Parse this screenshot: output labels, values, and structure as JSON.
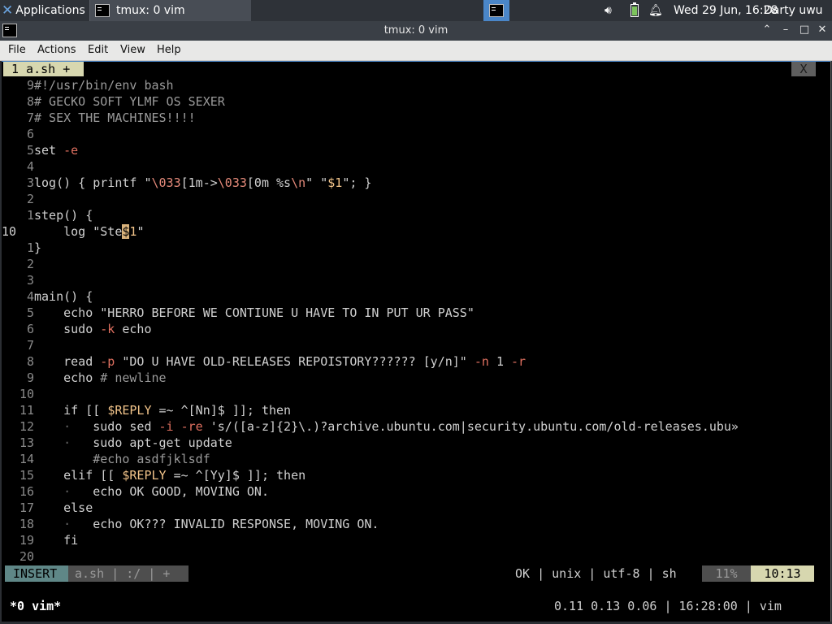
{
  "panel": {
    "apps_label": "Applications",
    "task_label": "tmux: 0 vim",
    "clock": "Wed 29 Jun, 16:28",
    "user": "Darty uwu"
  },
  "window": {
    "title": "tmux: 0 vim",
    "buttons": {
      "up": "⌃",
      "minimize": "–",
      "maximize": "□",
      "close": "✕"
    }
  },
  "menu": [
    "File",
    "Actions",
    "Edit",
    "View",
    "Help"
  ],
  "vim": {
    "tab_label": "1 a.sh +",
    "tab_close": "X",
    "lines": [
      {
        "num": "9",
        "text": "#!/usr/bin/env bash"
      },
      {
        "num": "8",
        "text": "# GECKO SOFT YLMF OS SEXER"
      },
      {
        "num": "7",
        "text": "# SEX THE MACHINES!!!!"
      },
      {
        "num": "6",
        "text": ""
      },
      {
        "num": "5",
        "text": "set -e"
      },
      {
        "num": "4",
        "text": ""
      },
      {
        "num": "3",
        "text": "log() { printf \"\\033[1m->\\033[0m %s\\n\" \"$1\"; }"
      },
      {
        "num": "2",
        "text": ""
      },
      {
        "num": "1",
        "text": "step() {"
      },
      {
        "num": "10",
        "text": "    log \"Ste$1\""
      },
      {
        "num": "1",
        "text": "}"
      },
      {
        "num": "2",
        "text": ""
      },
      {
        "num": "3",
        "text": ""
      },
      {
        "num": "4",
        "text": "main() {"
      },
      {
        "num": "5",
        "text": "    echo \"HERRO BEFORE WE CONTIUNE U HAVE TO IN PUT UR PASS\""
      },
      {
        "num": "6",
        "text": "    sudo -k echo"
      },
      {
        "num": "7",
        "text": ""
      },
      {
        "num": "8",
        "text": "    read -p \"DO U HAVE OLD-RELEASES REPOISTORY?????? [y/n]\" -n 1 -r"
      },
      {
        "num": "9",
        "text": "    echo # newline"
      },
      {
        "num": "10",
        "text": ""
      },
      {
        "num": "11",
        "text": "    if [[ $REPLY =~ ^[Nn]$ ]]; then"
      },
      {
        "num": "12",
        "text": "        sudo sed -i -re 's/([a-z]{2}\\.)?archive.ubuntu.com|security.ubuntu.com/old-releases.ubu»"
      },
      {
        "num": "13",
        "text": "        sudo apt-get update"
      },
      {
        "num": "14",
        "text": "        #echo asdfjklsdf"
      },
      {
        "num": "15",
        "text": "    elif [[ $REPLY =~ ^[Yy]$ ]]; then"
      },
      {
        "num": "16",
        "text": "        echo OK GOOD, MOVING ON."
      },
      {
        "num": "17",
        "text": "    else"
      },
      {
        "num": "18",
        "text": "        echo OK??? INVALID RESPONSE, MOVING ON."
      },
      {
        "num": "19",
        "text": "    fi"
      },
      {
        "num": "20",
        "text": ""
      }
    ],
    "status": {
      "mode": "INSERT",
      "file": "a.sh  |  :/  |  +",
      "right": "OK | unix | utf-8 | sh",
      "percent": "11%",
      "position": "10:13"
    }
  },
  "tmux": {
    "window": "*0 vim*",
    "right": "0.11 0.13 0.06 | 16:28:00 | vim"
  }
}
